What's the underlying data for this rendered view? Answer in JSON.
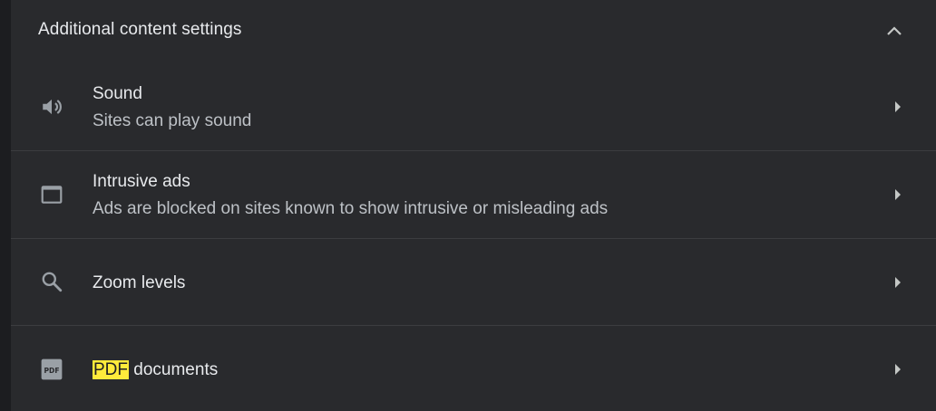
{
  "section": {
    "title": "Additional content settings",
    "collapse_icon": "chevron-up-icon"
  },
  "rows": [
    {
      "icon": "speaker-icon",
      "label": "Sound",
      "sublabel": "Sites can play sound"
    },
    {
      "icon": "window-icon",
      "label": "Intrusive ads",
      "sublabel": "Ads are blocked on sites known to show intrusive or misleading ads"
    },
    {
      "icon": "search-icon",
      "label": "Zoom levels"
    },
    {
      "icon": "pdf-icon",
      "label_highlight": "PDF",
      "label_rest": " documents"
    }
  ],
  "colors": {
    "background": "#202124",
    "card": "#292a2d",
    "text_primary": "#e8eaed",
    "text_secondary": "#bdc1c6",
    "divider": "#3c3d40",
    "highlight": "#ffeb3b",
    "icon": "#9aa0a6"
  }
}
